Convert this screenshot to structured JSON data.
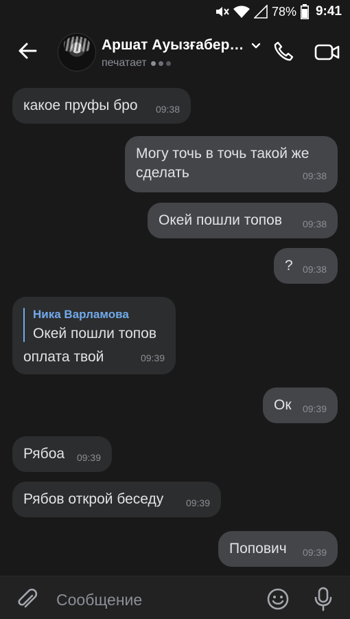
{
  "status_bar": {
    "battery_pct": "78%",
    "time": "9:41"
  },
  "header": {
    "title": "Аршат Ауызғабер…",
    "status": "печатает"
  },
  "messages": [
    {
      "dir": "in",
      "text": "какое пруфы бро",
      "time": "09:38"
    },
    {
      "dir": "out",
      "text": "Могу точь в точь такой же",
      "text2": "сделать",
      "time": "09:38"
    },
    {
      "dir": "out",
      "text": "Окей пошли топов",
      "time": "09:38"
    },
    {
      "dir": "out",
      "text": "?",
      "time": "09:38"
    },
    {
      "dir": "in",
      "reply_author": "Ника Варламова",
      "reply_text": "Окей пошли топов",
      "text": "оплата твой",
      "time": "09:39"
    },
    {
      "dir": "out",
      "text": "Ок",
      "time": "09:39"
    },
    {
      "dir": "in",
      "text": "Рябоа",
      "time": "09:39"
    },
    {
      "dir": "in",
      "text": "Рябов открой беседу",
      "time": "09:39"
    },
    {
      "dir": "out",
      "text": "Попович",
      "time": "09:39"
    }
  ],
  "composer": {
    "placeholder": "Сообщение"
  },
  "colors": {
    "background": "#19191a",
    "bubble_in": "#2c2d2e",
    "bubble_out": "#444549",
    "accent": "#71aaeb"
  },
  "icons": [
    "mute-icon",
    "wifi-icon",
    "signal-icon",
    "battery-icon",
    "back-arrow-icon",
    "chevron-down-icon",
    "phone-icon",
    "video-icon",
    "paperclip-icon",
    "emoji-icon",
    "microphone-icon"
  ]
}
